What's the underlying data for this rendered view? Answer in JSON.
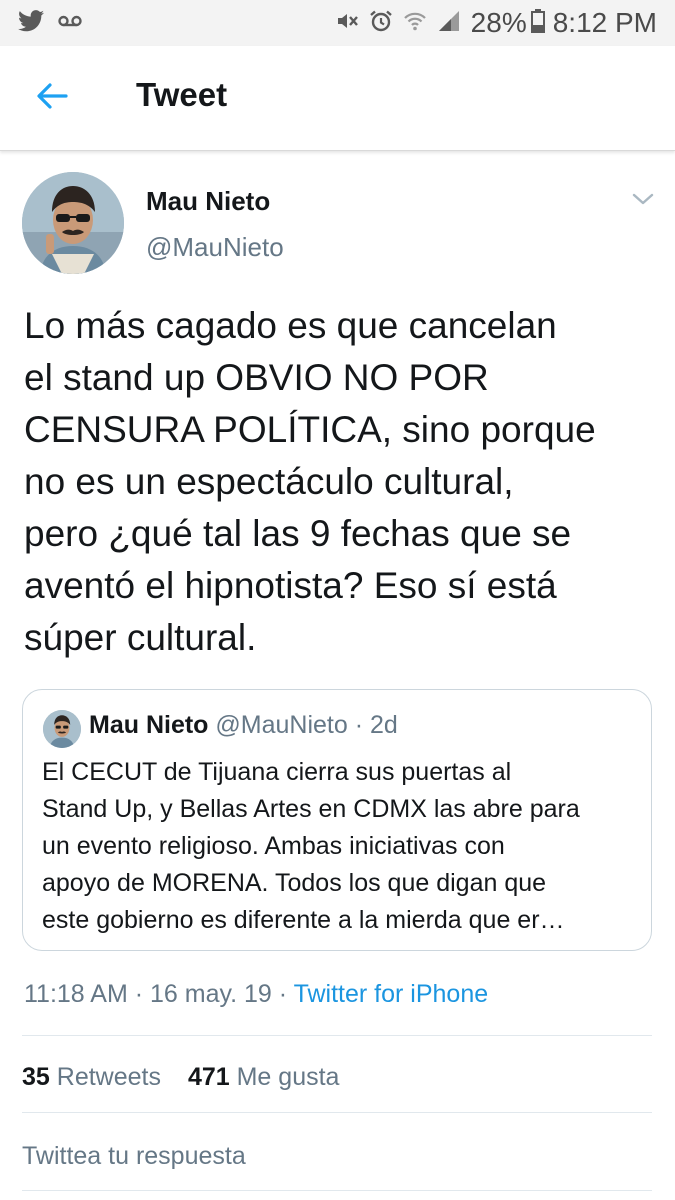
{
  "status_bar": {
    "battery": "28%",
    "time": "8:12 PM",
    "icons": [
      "twitter-bird-icon",
      "voicemail-icon",
      "mute-icon",
      "alarm-icon",
      "wifi-icon",
      "signal-icon",
      "battery-icon"
    ]
  },
  "header": {
    "title": "Tweet",
    "back_icon": "back-arrow-icon"
  },
  "tweet": {
    "author_name": "Mau Nieto",
    "author_handle": "@MauNieto",
    "text": "Lo más cagado es que cancelan\nel stand up OBVIO NO POR\nCENSURA POLÍTICA, sino porque\nno es un espectáculo cultural,\npero ¿qué tal las 9 fechas que se\naventó el hipnotista? Eso sí está\nsúper cultural.",
    "quoted": {
      "author_name": "Mau Nieto",
      "meta": "@MauNieto · 2d",
      "text": "El CECUT de Tijuana cierra sus puertas al\nStand Up, y Bellas Artes en CDMX las abre para\nun evento religioso. Ambas iniciativas con\napoyo de MORENA. Todos los que digan que\neste gobierno es diferente a la mierda que er…"
    },
    "timestamp": "11:18 AM · 16 may. 19 · ",
    "source": "Twitter for iPhone",
    "retweets_count": "35",
    "retweets_label": "Retweets",
    "likes_count": "471",
    "likes_label": "Me gusta"
  },
  "reply": {
    "placeholder": "Twittea tu respuesta"
  },
  "colors": {
    "link_blue": "#1b95e0",
    "secondary_gray": "#657786",
    "text_dark": "#14171a",
    "status_bar_bg": "#f3f3f3"
  }
}
